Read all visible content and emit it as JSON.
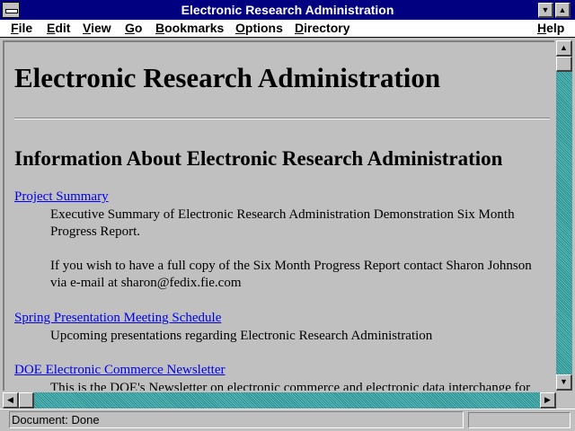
{
  "window": {
    "title": "Electronic Research Administration",
    "system_menu_icon": "system-menu-icon",
    "minimize_icon": "▼",
    "maximize_icon": "▲"
  },
  "menubar": {
    "items": [
      {
        "label": "File"
      },
      {
        "label": "Edit"
      },
      {
        "label": "View"
      },
      {
        "label": "Go"
      },
      {
        "label": "Bookmarks"
      },
      {
        "label": "Options"
      },
      {
        "label": "Directory"
      },
      {
        "label": "Help"
      }
    ]
  },
  "document": {
    "heading": "Electronic Research Administration",
    "subheading": "Information About Electronic Research Administration",
    "links": [
      {
        "label": "Project Summary",
        "lines": [
          "Executive Summary of Electronic Research Administration Demonstration Six Month",
          "Progress Report.",
          "",
          "If you wish to have a full copy of the Six Month Progress Report contact Sharon Johnson",
          "via e-mail at sharon@fedix.fie.com"
        ]
      },
      {
        "label": "Spring Presentation Meeting Schedule",
        "lines": [
          "Upcoming presentations regarding Electronic Research Administration"
        ]
      },
      {
        "label": "DOE Electronic Commerce Newsletter",
        "lines": [
          "This is the DOE's Newsletter on electronic commerce and electronic data interchange for"
        ]
      }
    ]
  },
  "scrollbars": {
    "up_arrow": "▲",
    "down_arrow": "▼",
    "left_arrow": "◀",
    "right_arrow": "▶"
  },
  "status": {
    "text": "Document: Done"
  }
}
